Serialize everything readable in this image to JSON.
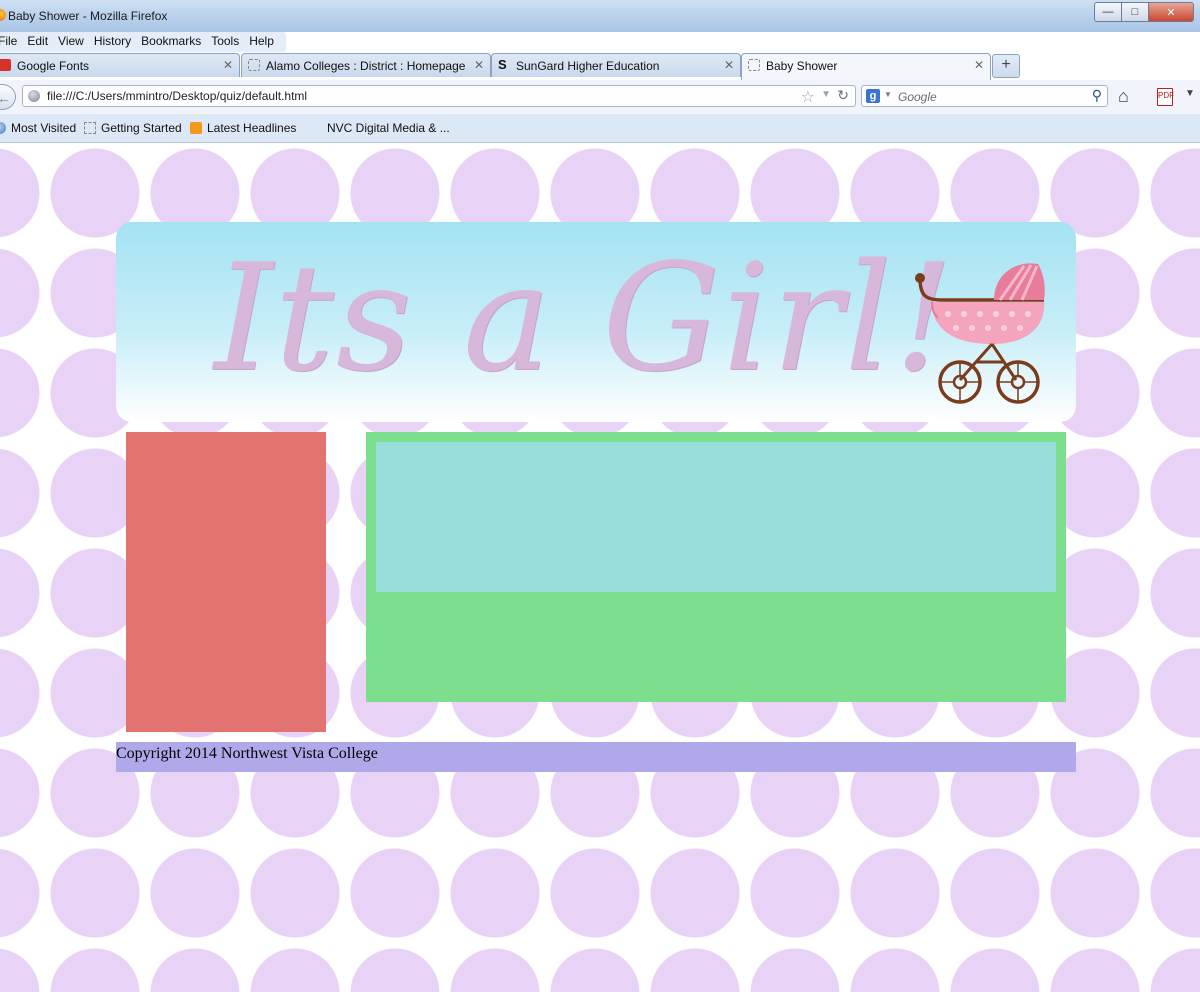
{
  "window": {
    "title": "Baby Shower - Mozilla Firefox"
  },
  "menu": [
    {
      "label": "File"
    },
    {
      "label": "Edit"
    },
    {
      "label": "View"
    },
    {
      "label": "History"
    },
    {
      "label": "Bookmarks"
    },
    {
      "label": "Tools"
    },
    {
      "label": "Help"
    }
  ],
  "tabs": [
    {
      "label": "Google Fonts",
      "active": false
    },
    {
      "label": "Alamo Colleges : District : Homepage",
      "active": false
    },
    {
      "label": "SunGard Higher Education",
      "active": false
    },
    {
      "label": "Baby Shower",
      "active": true
    }
  ],
  "navbar": {
    "url": "file:///C:/Users/mmintro/Desktop/quiz/default.html",
    "search_placeholder": "Google",
    "search_engine_letter": "g"
  },
  "bookmarks": [
    {
      "label": "Most Visited"
    },
    {
      "label": "Getting Started"
    },
    {
      "label": "Latest Headlines"
    },
    {
      "label": "NVC Digital Media & ..."
    }
  ],
  "page": {
    "headline": "Its a Girl!",
    "footer": "Copyright 2014 Northwest Vista College"
  },
  "colors": {
    "dots": "#e8d2f5",
    "header_top": "#a4e2f2",
    "sidebar": "#e37371",
    "main_panel": "#7ddf8d",
    "main_inner": "#99dfd9",
    "footer": "#afa9e9",
    "headline": "#d8b8da"
  },
  "icons": {
    "stroller": "baby-stroller-icon",
    "home": "home-icon",
    "back": "back-arrow-icon",
    "star": "bookmark-star-icon",
    "reload": "reload-icon",
    "search": "search-icon"
  }
}
